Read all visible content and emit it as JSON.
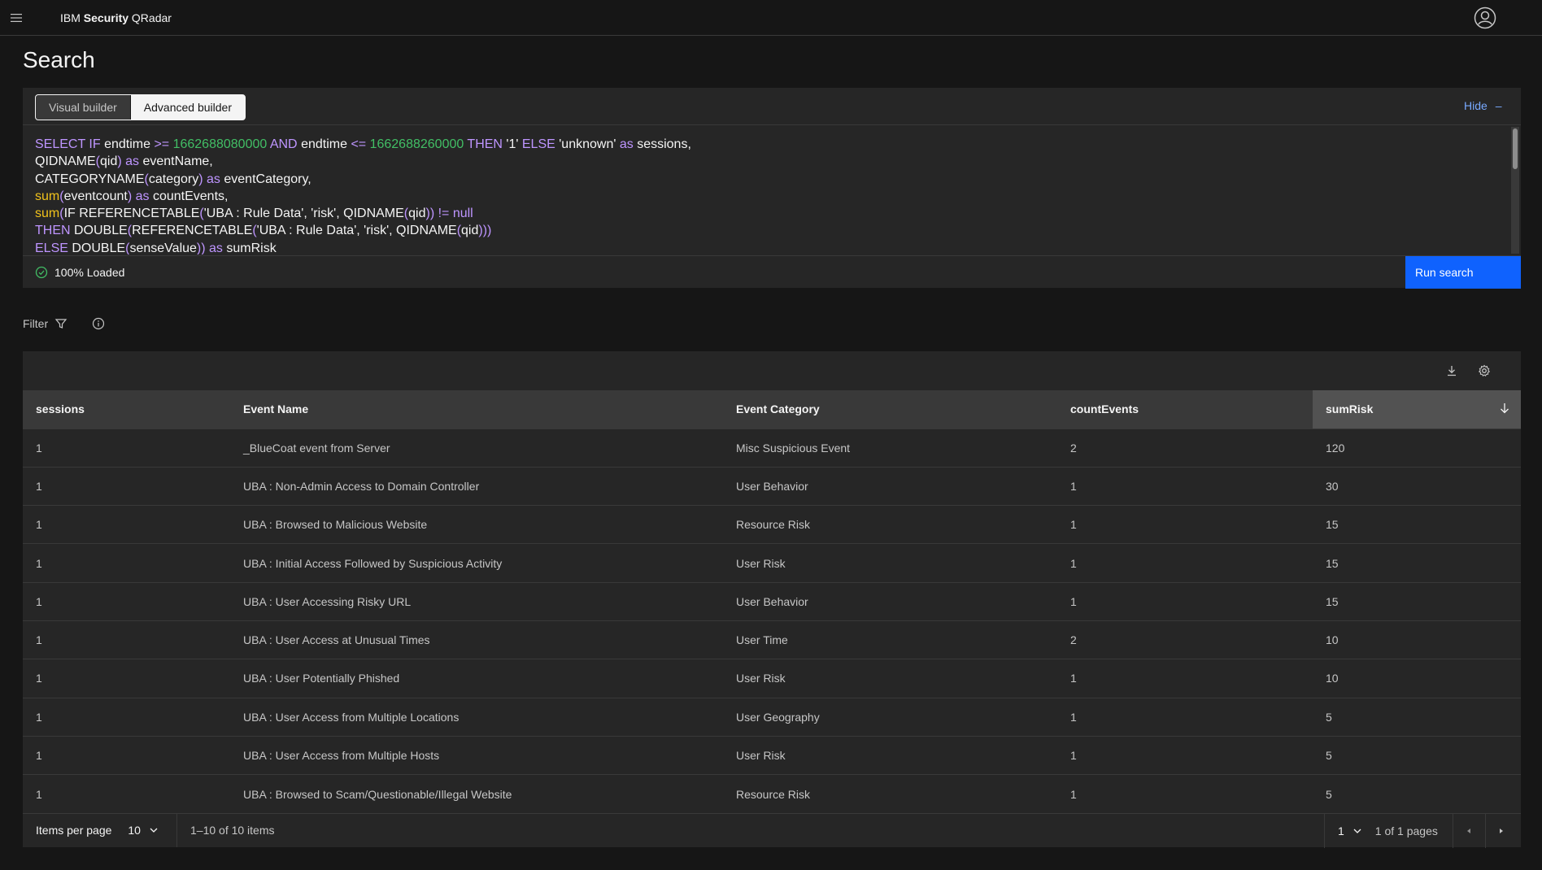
{
  "app": {
    "brand_prefix": "IBM ",
    "brand_strong": "Security",
    "brand_suffix": " QRadar"
  },
  "page": {
    "title": "Search"
  },
  "builder": {
    "visual_label": "Visual builder",
    "advanced_label": "Advanced builder",
    "hide_label": "Hide",
    "hide_symbol": "–"
  },
  "query_lines": [
    [
      [
        "kw",
        "SELECT IF "
      ],
      [
        "str",
        "endtime "
      ],
      [
        "kw",
        ">= "
      ],
      [
        "num",
        "1662688080000 "
      ],
      [
        "kw",
        "AND "
      ],
      [
        "str",
        "endtime "
      ],
      [
        "kw",
        "<= "
      ],
      [
        "num",
        "1662688260000 "
      ],
      [
        "kw",
        "THEN "
      ],
      [
        "str",
        "'1' "
      ],
      [
        "kw",
        "ELSE "
      ],
      [
        "str",
        "'unknown' "
      ],
      [
        "kw",
        "as "
      ],
      [
        "str",
        "sessions,"
      ]
    ],
    [
      [
        "str",
        "QIDNAME"
      ],
      [
        "kw",
        "("
      ],
      [
        "str",
        "qid"
      ],
      [
        "kw",
        ") as "
      ],
      [
        "str",
        "eventName,"
      ]
    ],
    [
      [
        "str",
        "CATEGORYNAME"
      ],
      [
        "kw",
        "("
      ],
      [
        "str",
        "category"
      ],
      [
        "kw",
        ") as "
      ],
      [
        "str",
        "eventCategory,"
      ]
    ],
    [
      [
        "fn",
        "sum"
      ],
      [
        "kw",
        "("
      ],
      [
        "str",
        "eventcount"
      ],
      [
        "kw",
        ") as "
      ],
      [
        "str",
        "countEvents,"
      ]
    ],
    [
      [
        "fn",
        "sum"
      ],
      [
        "kw",
        "("
      ],
      [
        "str",
        "IF REFERENCETABLE"
      ],
      [
        "kw",
        "("
      ],
      [
        "str",
        "'UBA : Rule Data', 'risk', QIDNAME"
      ],
      [
        "kw",
        "("
      ],
      [
        "str",
        "qid"
      ],
      [
        "kw",
        "))"
      ],
      [
        "kw",
        " != null"
      ]
    ],
    [
      [
        "kw",
        "THEN "
      ],
      [
        "str",
        "DOUBLE"
      ],
      [
        "kw",
        "("
      ],
      [
        "str",
        "REFERENCETABLE"
      ],
      [
        "kw",
        "("
      ],
      [
        "str",
        "'UBA : Rule Data', 'risk', QIDNAME"
      ],
      [
        "kw",
        "("
      ],
      [
        "str",
        "qid"
      ],
      [
        "kw",
        ")))"
      ]
    ],
    [
      [
        "kw",
        "ELSE "
      ],
      [
        "str",
        "DOUBLE"
      ],
      [
        "kw",
        "("
      ],
      [
        "str",
        "senseValue"
      ],
      [
        "kw",
        ")) as "
      ],
      [
        "str",
        "sumRisk"
      ]
    ]
  ],
  "status": {
    "loaded_label": "100% Loaded"
  },
  "run_label": "Run search",
  "filter": {
    "label": "Filter"
  },
  "table": {
    "columns": [
      "sessions",
      "Event Name",
      "Event Category",
      "countEvents",
      "sumRisk"
    ],
    "rows": [
      [
        "1",
        "_BlueCoat event from Server",
        "Misc Suspicious Event",
        "2",
        "120"
      ],
      [
        "1",
        "UBA : Non-Admin Access to Domain Controller",
        "User Behavior",
        "1",
        "30"
      ],
      [
        "1",
        "UBA : Browsed to Malicious Website",
        "Resource Risk",
        "1",
        "15"
      ],
      [
        "1",
        "UBA : Initial Access Followed by Suspicious Activity",
        "User Risk",
        "1",
        "15"
      ],
      [
        "1",
        "UBA : User Accessing Risky URL",
        "User Behavior",
        "1",
        "15"
      ],
      [
        "1",
        "UBA : User Access at Unusual Times",
        "User Time",
        "2",
        "10"
      ],
      [
        "1",
        "UBA : User Potentially Phished",
        "User Risk",
        "1",
        "10"
      ],
      [
        "1",
        "UBA : User Access from Multiple Locations",
        "User Geography",
        "1",
        "5"
      ],
      [
        "1",
        "UBA : User Access from Multiple Hosts",
        "User Risk",
        "1",
        "5"
      ],
      [
        "1",
        "UBA : Browsed to Scam/Questionable/Illegal Website",
        "Resource Risk",
        "1",
        "5"
      ]
    ]
  },
  "pagination": {
    "items_per_page_label": "Items per page",
    "items_per_page": "10",
    "range": "1–10 of 10 items",
    "page": "1",
    "of_pages": "1 of 1 pages"
  },
  "colors": {
    "accent": "#0f62fe",
    "link": "#78a9ff",
    "success": "#42be65"
  }
}
